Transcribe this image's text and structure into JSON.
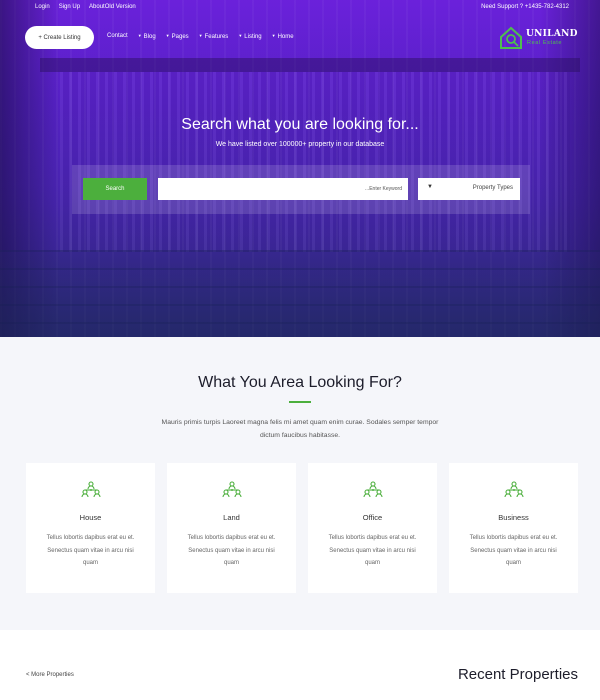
{
  "topbar": {
    "links": [
      "Login",
      "Sign Up",
      "AboutOld Version"
    ],
    "support": "Need Support ? +1435-782-4312"
  },
  "nav": {
    "create_label": "+ Create Listing",
    "items": [
      "Contact",
      "Blog",
      "Pages",
      "Features",
      "Listing",
      "Home"
    ]
  },
  "logo": {
    "name": "UNILAND",
    "sub": "Real Estate",
    "colors": {
      "mark": "#4ec04e"
    }
  },
  "hero": {
    "title": "Search what you are looking for...",
    "subtitle": "We have listed over 100000+ property in our database",
    "search_label": "Search",
    "keyword_placeholder": "...Enter Keyword",
    "property_type": "Property Types"
  },
  "section": {
    "title": "What You Area Looking For?",
    "description": "Mauris primis turpis Laoreet magna felis mi amet quam enim curae. Sodales semper tempor dictum faucibus habitasse."
  },
  "cards": [
    {
      "title": "House",
      "text": "Tellus lobortis dapibus erat eu et. Senectus quam vitae in arcu nisi quam",
      "icon": "people-hierarchy-icon"
    },
    {
      "title": "Land",
      "text": "Tellus lobortis dapibus erat eu et. Senectus quam vitae in arcu nisi quam",
      "icon": "people-hierarchy-icon"
    },
    {
      "title": "Office",
      "text": "Tellus lobortis dapibus erat eu et. Senectus quam vitae in arcu nisi quam",
      "icon": "people-hierarchy-icon"
    },
    {
      "title": "Business",
      "text": "Tellus lobortis dapibus erat eu et. Senectus quam vitae in arcu nisi quam",
      "icon": "people-hierarchy-icon"
    }
  ],
  "recent": {
    "more_label": "< More Properties",
    "title": "Recent Properties"
  },
  "colors": {
    "accent": "#4caf3d",
    "hero": "#5a1ed0"
  }
}
